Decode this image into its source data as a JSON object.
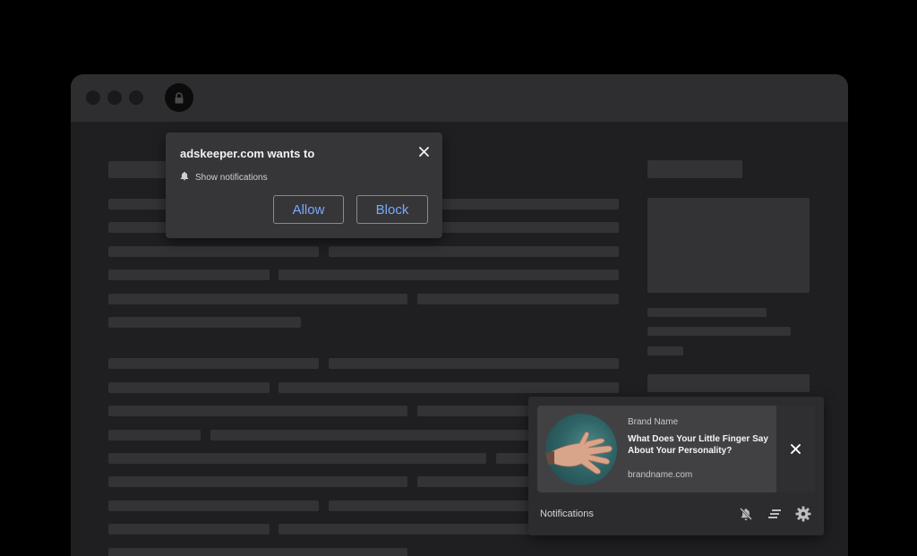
{
  "prompt": {
    "title": "adskeeper.com wants to",
    "permission_label": "Show notifications",
    "allow_label": "Allow",
    "block_label": "Block",
    "icons": {
      "bell": "bell-icon",
      "close": "close-icon"
    }
  },
  "notification": {
    "brand": "Brand Name",
    "headline": "What Does Your Little Finger Say About Your Personality?",
    "domain": "brandname.com",
    "image": "hand-photo",
    "icons": {
      "close": "close-icon"
    }
  },
  "notification_center": {
    "label": "Notifications",
    "icons": [
      "bell-off-icon",
      "clear-all-icon",
      "gear-icon"
    ]
  },
  "browser": {
    "icons": [
      "window-dot",
      "lock-icon"
    ]
  },
  "colors": {
    "background": "#000000",
    "window": "#1f1f21",
    "titlebar": "#2e2e31",
    "skeleton": "#333336",
    "prompt": "#363638",
    "accent": "#7aa7ff",
    "notification_card": "#414144"
  }
}
